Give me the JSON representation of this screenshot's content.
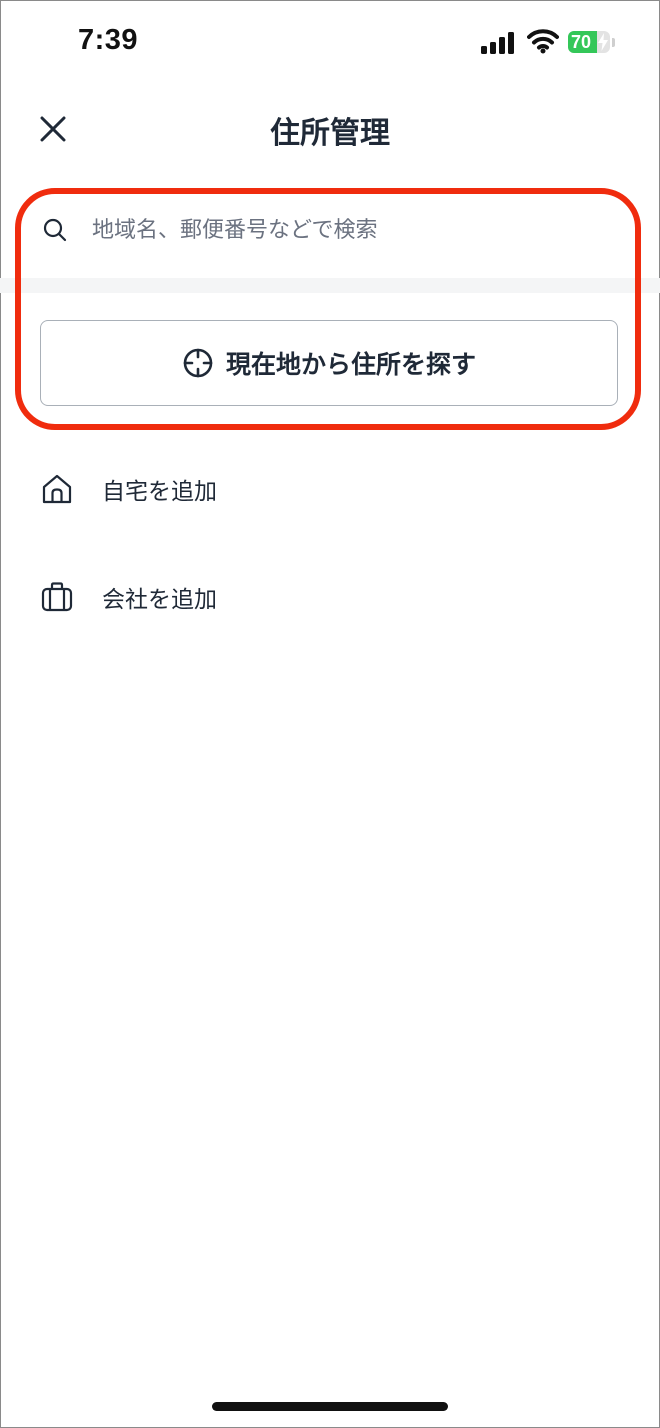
{
  "status_bar": {
    "time": "7:39",
    "battery_level": "70",
    "battery_fraction": 0.7,
    "icons": [
      "signal-icon",
      "wifi-icon",
      "battery-icon"
    ]
  },
  "header": {
    "title": "住所管理",
    "close_icon": "close-icon"
  },
  "search": {
    "placeholder": "地域名、郵便番号などで検索",
    "value": "",
    "icon": "search-icon"
  },
  "locate": {
    "label": "現在地から住所を探す",
    "icon": "crosshair-icon"
  },
  "saved_places": [
    {
      "label": "自宅を追加",
      "icon": "home-icon"
    },
    {
      "label": "会社を追加",
      "icon": "briefcase-icon"
    }
  ],
  "colors": {
    "highlight": "#f02c0e",
    "text": "#1f2937",
    "battery": "#34c759"
  }
}
